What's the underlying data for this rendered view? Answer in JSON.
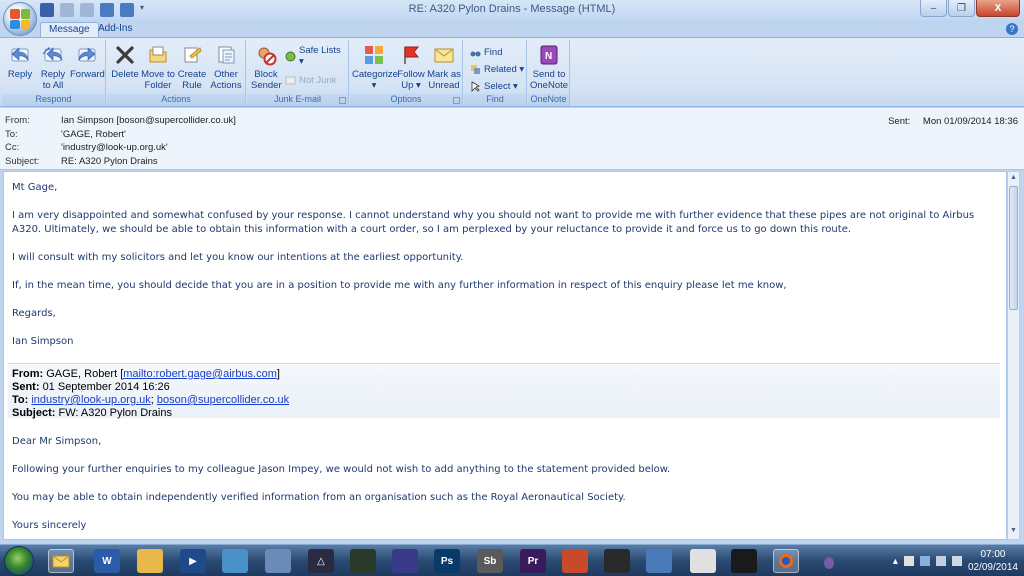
{
  "window": {
    "title": "RE: A320 Pylon Drains - Message (HTML)",
    "min_label": "–",
    "max_label": "❐",
    "close_label": "X"
  },
  "tabs": [
    {
      "label": "Message",
      "active": true
    },
    {
      "label": "Add-Ins",
      "active": false
    }
  ],
  "ribbon": {
    "respond": {
      "label": "Respond",
      "reply": "Reply",
      "reply_all_1": "Reply",
      "reply_all_2": "to All",
      "forward": "Forward"
    },
    "actions": {
      "label": "Actions",
      "delete": "Delete",
      "move_1": "Move to",
      "move_2": "Folder ▾",
      "rule_1": "Create",
      "rule_2": "Rule",
      "other_1": "Other",
      "other_2": "Actions ▾"
    },
    "junk": {
      "label": "Junk E-mail",
      "block_1": "Block",
      "block_2": "Sender",
      "safe_lists": "Safe Lists ▾",
      "not_junk": "Not Junk"
    },
    "options": {
      "label": "Options",
      "categorize": "Categorize",
      "categorize_arrow": "▾",
      "follow_1": "Follow",
      "follow_2": "Up ▾",
      "mark_1": "Mark as",
      "mark_2": "Unread"
    },
    "find": {
      "label": "Find",
      "find": "Find",
      "related": "Related ▾",
      "select": "Select ▾"
    },
    "onenote": {
      "label": "OneNote",
      "send_1": "Send to",
      "send_2": "OneNote"
    }
  },
  "header": {
    "from_label": "From:",
    "from": "Ian Simpson [boson@supercollider.co.uk]",
    "to_label": "To:",
    "to": "'GAGE, Robert'",
    "cc_label": "Cc:",
    "cc": "'industry@look-up.org.uk'",
    "subject_label": "Subject:",
    "subject": "RE: A320 Pylon Drains",
    "sent_label": "Sent:",
    "sent": "Mon 01/09/2014 18:36"
  },
  "body": {
    "greeting": "Mt Gage,",
    "p1": "I am very disappointed and somewhat confused by your response. I cannot understand why you should not want to provide me with further evidence that these pipes are not original to Airbus A320. Ultimately, we should be able to obtain this information with a court order, so I am perplexed by your reluctance to provide it and force us to go down this route.",
    "p2": "I will consult with my solicitors and let you know our intentions at the earliest opportunity.",
    "p3": "If, in the mean time, you should decide that you are in a position to provide me with any further information in respect of this enquiry please let me know,",
    "regards": "Regards,",
    "signature": "Ian Simpson",
    "fwd": {
      "from_label": "From:",
      "from_name": "GAGE, Robert [",
      "from_link": "mailto:robert.gage@airbus.com",
      "from_close": "]",
      "sent_label": "Sent:",
      "sent": "01 September 2014 16:26",
      "to_label": "To:",
      "to_link1": "industry@look-up.org.uk",
      "to_sep": ";",
      "to_link2": "boson@supercollider.co.uk",
      "subject_label": "Subject:",
      "subject": "FW: A320 Pylon Drains"
    },
    "q_greeting": "Dear Mr Simpson,",
    "q_p1": "Following your further enquiries to my colleague Jason Impey, we would not wish to add anything to the statement provided below.",
    "q_p2": "You may be able to obtain independently verified information from an organisation such as the Royal Aeronautical Society.",
    "q_closing": "Yours sincerely"
  },
  "taskbar": {
    "time": "07:00",
    "date": "02/09/2014",
    "apps": [
      "Ps",
      "Sb",
      "Pr"
    ]
  }
}
